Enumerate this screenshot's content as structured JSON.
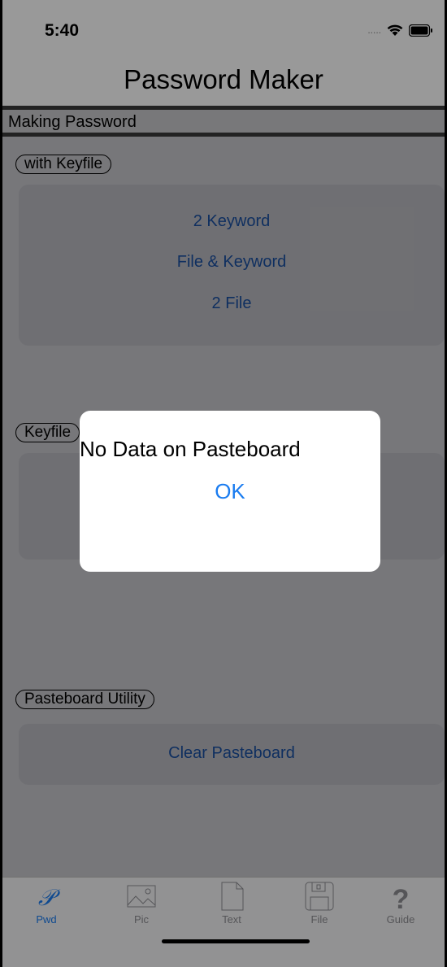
{
  "status_bar": {
    "time": "5:40",
    "signal": "....."
  },
  "nav": {
    "title": "Password Maker"
  },
  "section": {
    "header": "Making Password"
  },
  "keyfile_group": {
    "pill": "with Keyfile",
    "buttons": [
      "2 Keyword",
      "File & Keyword",
      "2 File"
    ]
  },
  "keyfile2_group": {
    "pill": "Keyfile"
  },
  "pasteboard_group": {
    "pill": "Pasteboard Utility",
    "clear_button": "Clear Pasteboard"
  },
  "alert": {
    "message": "No Data on Pasteboard",
    "ok_label": "OK"
  },
  "tabs": [
    {
      "label": "Pwd",
      "icon": "script-p-icon",
      "selected": true
    },
    {
      "label": "Pic",
      "icon": "image-icon",
      "selected": false
    },
    {
      "label": "Text",
      "icon": "document-icon",
      "selected": false
    },
    {
      "label": "File",
      "icon": "floppy-disk-icon",
      "selected": false
    },
    {
      "label": "Guide",
      "icon": "question-mark-icon",
      "selected": false
    }
  ],
  "colors": {
    "accent": "#1a7cf0",
    "link": "#1a4fa0",
    "tab_selected": "#1a7cf0",
    "tab_inactive": "#8e8e93"
  }
}
